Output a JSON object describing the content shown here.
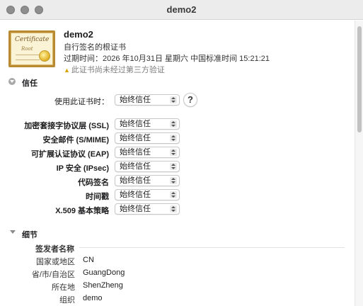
{
  "window": {
    "title": "demo2"
  },
  "certificate": {
    "name": "demo2",
    "kind": "自行签名的根证书",
    "expiry": "过期时间：2026 年10月31日 星期六 中国标准时间 15:21:21",
    "warning": "此证书尚未经过第三方验证",
    "icon_text_title": "Certificate",
    "icon_text_sub": "Root"
  },
  "trust": {
    "section_label": "信任",
    "when_using_label": "使用此证书时：",
    "when_using_value": "始终信任",
    "help_label": "?",
    "items": [
      {
        "label": "加密套接字协议层 (SSL)",
        "value": "始终信任"
      },
      {
        "label": "安全邮件 (S/MIME)",
        "value": "始终信任"
      },
      {
        "label": "可扩展认证协议 (EAP)",
        "value": "始终信任"
      },
      {
        "label": "IP 安全 (IPsec)",
        "value": "始终信任"
      },
      {
        "label": "代码签名",
        "value": "始终信任"
      },
      {
        "label": "时间戳",
        "value": "始终信任"
      },
      {
        "label": "X.509 基本策略",
        "value": "始终信任"
      }
    ]
  },
  "details": {
    "section_label": "细节",
    "issuer_header": "签发者名称",
    "rows": [
      {
        "label": "国家或地区",
        "value": "CN"
      },
      {
        "label": "省/市/自治区",
        "value": "GuangDong"
      },
      {
        "label": "所在地",
        "value": "ShenZheng"
      },
      {
        "label": "组织",
        "value": "demo"
      }
    ]
  },
  "colors": {
    "accent_warning": "#d9a400",
    "titlebar": "#ececec"
  }
}
